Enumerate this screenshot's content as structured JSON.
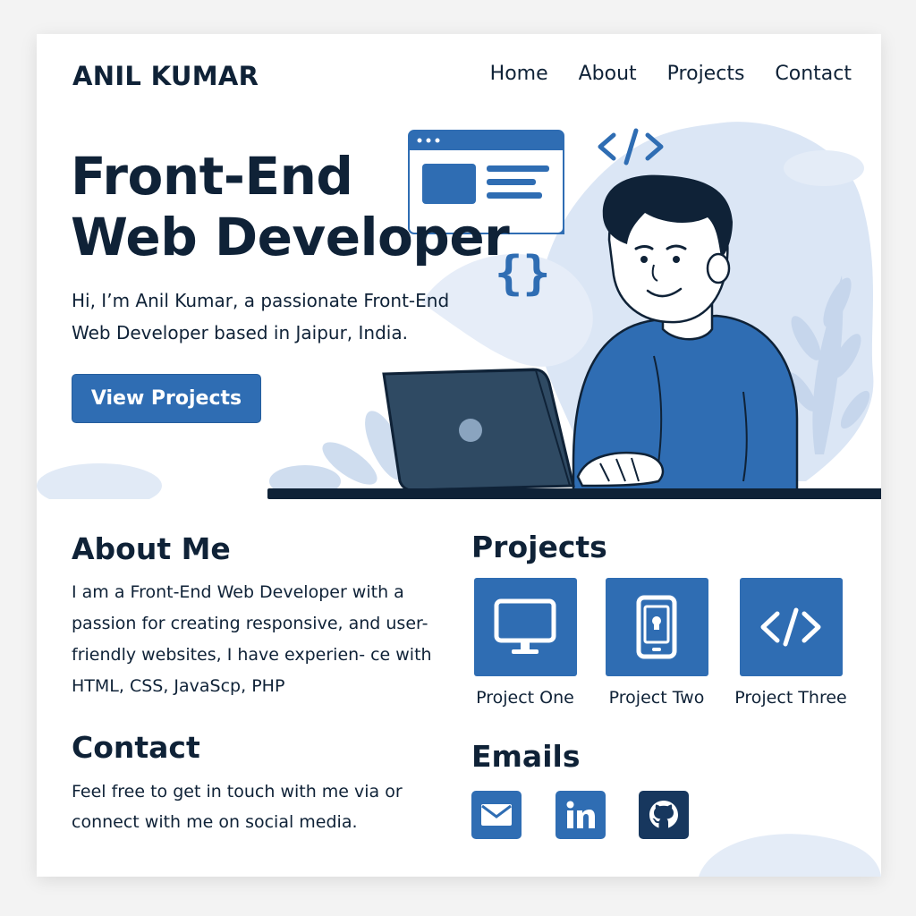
{
  "header": {
    "brand": "ANIL KUMAR",
    "nav": [
      "Home",
      "About",
      "Projects",
      "Contact"
    ]
  },
  "hero": {
    "title_line1": "Front-End",
    "title_line2": "Web Developer",
    "subtitle": "Hi, I’m Anil Kumar, a passionate Front-End Web Developer based in Jaipur, India.",
    "cta_label": "View Projects"
  },
  "about": {
    "title": "About Me",
    "text": "I am a Front-End Web Developer with a passion for creating responsive, and user-friendly websites, I have experien- ce with HTML, CSS, JavaScp, PHP"
  },
  "contact": {
    "title": "Contact",
    "text": "Feel free to get in touch with me via or connect with me on social media."
  },
  "projects": {
    "title": "Projects",
    "items": [
      {
        "name": "Project One",
        "icon": "monitor-icon"
      },
      {
        "name": "Project Two",
        "icon": "mobile-icon"
      },
      {
        "name": "Project Three",
        "icon": "code-icon"
      }
    ]
  },
  "emails": {
    "title": "Emails",
    "links": [
      {
        "icon": "mail-icon"
      },
      {
        "icon": "linkedin-icon"
      },
      {
        "icon": "github-icon"
      }
    ]
  },
  "colors": {
    "accent": "#2f6db3",
    "text": "#0f2237",
    "light_blue": "#dbe6f5",
    "github_bg": "#17375e"
  }
}
